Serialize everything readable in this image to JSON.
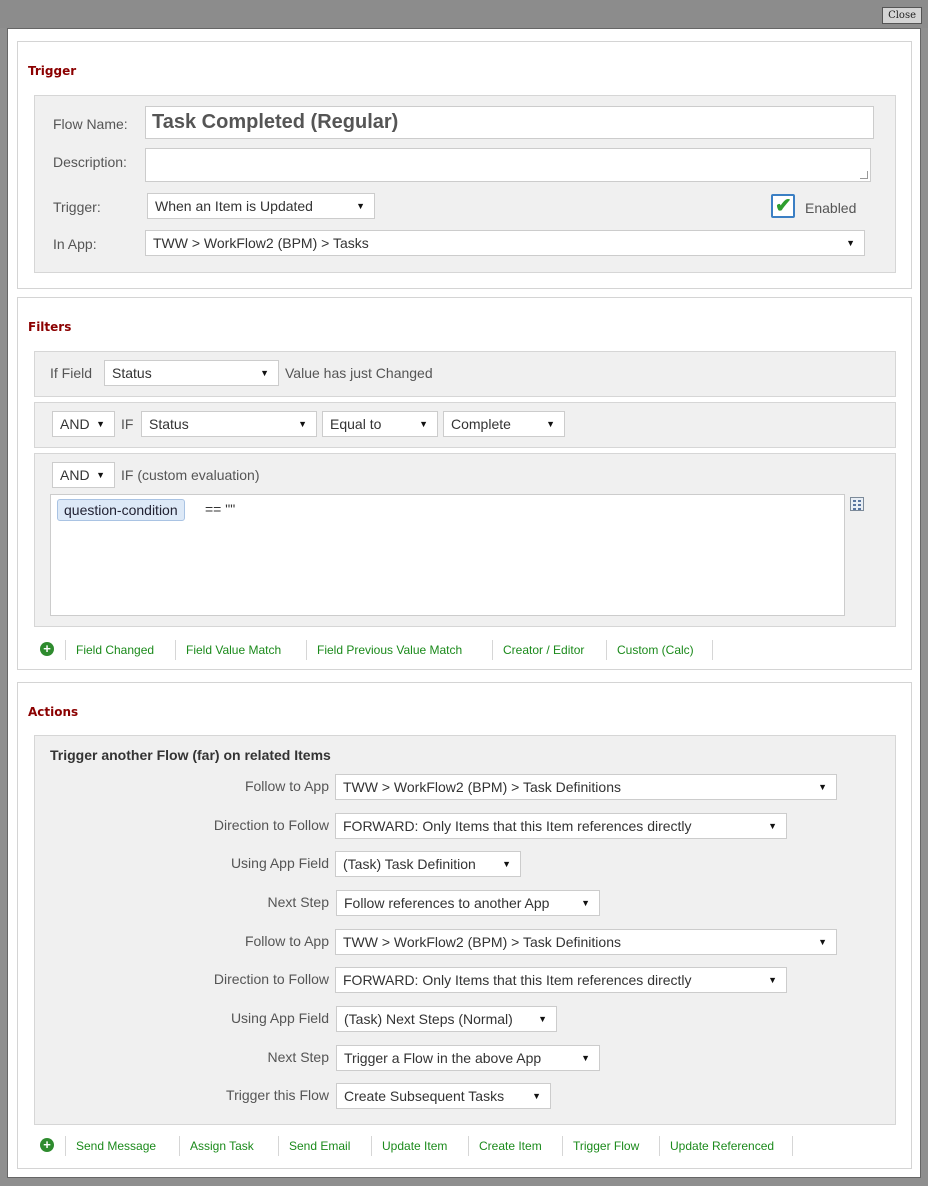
{
  "window": {
    "close_label": "Close"
  },
  "trigger": {
    "title": "Trigger",
    "flow_name_label": "Flow Name:",
    "flow_name_value": "Task Completed (Regular)",
    "description_label": "Description:",
    "description_value": "",
    "trigger_label": "Trigger:",
    "trigger_value": "When an Item is Updated",
    "enabled_label": "Enabled",
    "enabled_checked": true,
    "in_app_label": "In App:",
    "in_app_value": "TWW > WorkFlow2 (BPM) > Tasks"
  },
  "filters": {
    "title": "Filters",
    "row1": {
      "if_field_label": "If Field",
      "field_value": "Status",
      "suffix_label": "Value has just Changed"
    },
    "row2": {
      "conj_value": "AND",
      "if_label": "IF",
      "field_value": "Status",
      "operator_value": "Equal to",
      "target_value": "Complete"
    },
    "row3": {
      "conj_value": "AND",
      "label": "IF (custom evaluation)",
      "token": "question-condition",
      "expression_rest": "== \"\""
    },
    "add_links": [
      "Field Changed",
      "Field Value Match",
      "Field Previous Value Match",
      "Creator / Editor",
      "Custom (Calc)"
    ]
  },
  "actions": {
    "title": "Actions",
    "heading": "Trigger another Flow (far) on related Items",
    "rows": [
      {
        "label": "Follow to App",
        "value": "TWW > WorkFlow2 (BPM) > Task Definitions"
      },
      {
        "label": "Direction to Follow",
        "value": "FORWARD: Only Items that this Item references directly"
      },
      {
        "label": "Using App Field",
        "value": "(Task) Task Definition"
      },
      {
        "label": "Next Step",
        "value": "Follow references to another App"
      },
      {
        "label": "Follow to App",
        "value": "TWW > WorkFlow2 (BPM) > Task Definitions"
      },
      {
        "label": "Direction to Follow",
        "value": "FORWARD: Only Items that this Item references directly"
      },
      {
        "label": "Using App Field",
        "value": "(Task) Next Steps (Normal)"
      },
      {
        "label": "Next Step",
        "value": "Trigger a Flow in the above App"
      },
      {
        "label": "Trigger this Flow",
        "value": "Create Subsequent Tasks"
      }
    ],
    "add_links": [
      "Send Message",
      "Assign Task",
      "Send Email",
      "Update Item",
      "Create Item",
      "Trigger Flow",
      "Update Referenced"
    ]
  },
  "colors": {
    "section_title": "#8b0000",
    "link": "#1b8a1b",
    "panel_bg": "#f0f0f0",
    "check": "#2e9e2e"
  },
  "icons": {
    "add": "plus-circle-icon",
    "calc": "calculator-icon",
    "dropdown": "triangle-down-icon",
    "check": "checkmark-icon"
  }
}
